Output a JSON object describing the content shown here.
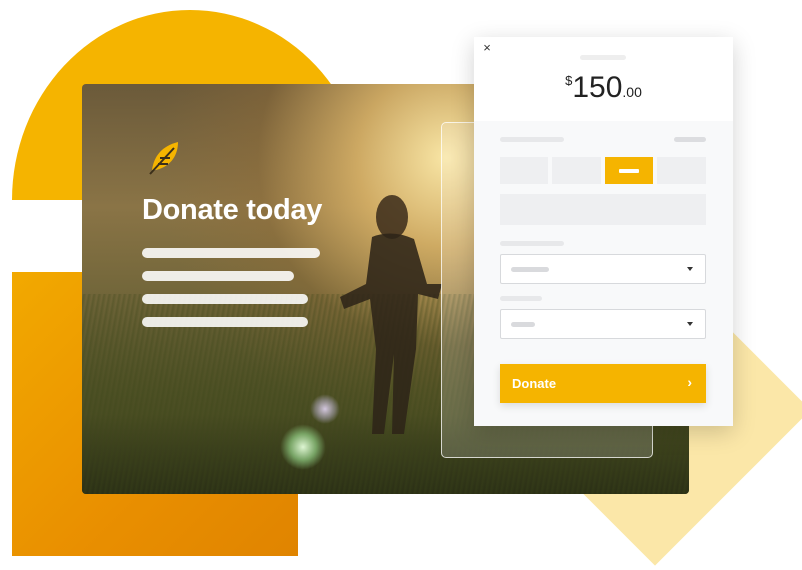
{
  "hero": {
    "title": "Donate today"
  },
  "form": {
    "close_icon": "×",
    "amount": {
      "currency": "$",
      "whole": "150",
      "cents": ".00"
    },
    "donate_button": {
      "label": "Donate",
      "chevron": "›"
    }
  },
  "icons": [
    "leaf-logo-icon",
    "close-icon",
    "caret-down-icon",
    "chevron-right-icon"
  ],
  "colors": {
    "accent": "#f5b400",
    "orange": "#e98f00",
    "diamond": "#fbe7a8"
  }
}
